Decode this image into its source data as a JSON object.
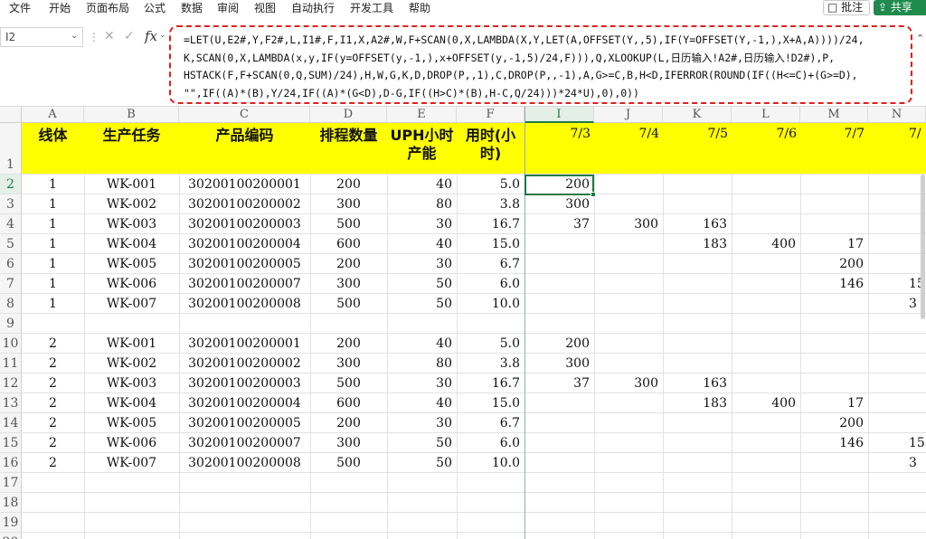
{
  "menu": [
    "文件",
    "开始",
    "页面布局",
    "公式",
    "数据",
    "审阅",
    "视图",
    "自动执行",
    "开发工具",
    "帮助"
  ],
  "comment_label": "批注",
  "share_label": "共享",
  "name_box": "I2",
  "fx_label": "fx",
  "formula_lines": [
    "=LET(U,E2#,Y,F2#,L,I1#,F,I1,X,A2#,W,F+SCAN(0,X,LAMBDA(X,Y,LET(A,OFFSET(Y,,5),IF(Y=OFFSET(Y,-1,),X+A,A))))/24,",
    "K,SCAN(0,X,LAMBDA(x,y,IF(y=OFFSET(y,-1,),x+OFFSET(y,-1,5)/24,F))),Q,XLOOKUP(L,日历输入!A2#,日历输入!D2#),P,",
    "HSTACK(F,F+SCAN(0,Q,SUM)/24),H,W,G,K,D,DROP(P,,1),C,DROP(P,,-1),A,G>=C,B,H<D,IFERROR(ROUND(IF((H<=C)+(G>=D),",
    "\"\",IF((A)*(B),Y/24,IF((A)*(G<D),D-G,IF((H>C)*(B),H-C,Q/24)))*24*U),0),0))"
  ],
  "columns": [
    "A",
    "B",
    "C",
    "D",
    "E",
    "F",
    "I",
    "J",
    "K",
    "L",
    "M",
    "N"
  ],
  "row_numbers": [
    "1",
    "2",
    "3",
    "4",
    "5",
    "6",
    "7",
    "8",
    "9",
    "10",
    "11",
    "12",
    "13",
    "14",
    "15",
    "16",
    "17",
    "18",
    "19",
    "20"
  ],
  "headers": {
    "line": "线体",
    "task": "生产任务",
    "code": "产品编码",
    "qty": "排程数量",
    "uph_1": "UPH小时",
    "uph_2": "产能",
    "time_1": "用时(小",
    "time_2": "时)"
  },
  "dates": [
    "7/3",
    "7/4",
    "7/5",
    "7/6",
    "7/7",
    "7/"
  ],
  "rows": [
    {
      "line": "1",
      "task": "WK-001",
      "code": "30200100200001",
      "qty": "200",
      "uph": "40",
      "time": "5.0",
      "d": [
        "200",
        "",
        "",
        "",
        "",
        ""
      ]
    },
    {
      "line": "1",
      "task": "WK-002",
      "code": "30200100200002",
      "qty": "300",
      "uph": "80",
      "time": "3.8",
      "d": [
        "300",
        "",
        "",
        "",
        "",
        ""
      ]
    },
    {
      "line": "1",
      "task": "WK-003",
      "code": "30200100200003",
      "qty": "500",
      "uph": "30",
      "time": "16.7",
      "d": [
        "37",
        "300",
        "163",
        "",
        "",
        ""
      ]
    },
    {
      "line": "1",
      "task": "WK-004",
      "code": "30200100200004",
      "qty": "600",
      "uph": "40",
      "time": "15.0",
      "d": [
        "",
        "",
        "183",
        "400",
        "17",
        ""
      ]
    },
    {
      "line": "1",
      "task": "WK-005",
      "code": "30200100200005",
      "qty": "200",
      "uph": "30",
      "time": "6.7",
      "d": [
        "",
        "",
        "",
        "",
        "200",
        ""
      ]
    },
    {
      "line": "1",
      "task": "WK-006",
      "code": "30200100200007",
      "qty": "300",
      "uph": "50",
      "time": "6.0",
      "d": [
        "",
        "",
        "",
        "",
        "146",
        "15"
      ]
    },
    {
      "line": "1",
      "task": "WK-007",
      "code": "30200100200008",
      "qty": "500",
      "uph": "50",
      "time": "10.0",
      "d": [
        "",
        "",
        "",
        "",
        "",
        "3"
      ]
    },
    {
      "line": "",
      "task": "",
      "code": "",
      "qty": "",
      "uph": "",
      "time": "",
      "d": [
        "",
        "",
        "",
        "",
        "",
        ""
      ]
    },
    {
      "line": "2",
      "task": "WK-001",
      "code": "30200100200001",
      "qty": "200",
      "uph": "40",
      "time": "5.0",
      "d": [
        "200",
        "",
        "",
        "",
        "",
        ""
      ]
    },
    {
      "line": "2",
      "task": "WK-002",
      "code": "30200100200002",
      "qty": "300",
      "uph": "80",
      "time": "3.8",
      "d": [
        "300",
        "",
        "",
        "",
        "",
        ""
      ]
    },
    {
      "line": "2",
      "task": "WK-003",
      "code": "30200100200003",
      "qty": "500",
      "uph": "30",
      "time": "16.7",
      "d": [
        "37",
        "300",
        "163",
        "",
        "",
        ""
      ]
    },
    {
      "line": "2",
      "task": "WK-004",
      "code": "30200100200004",
      "qty": "600",
      "uph": "40",
      "time": "15.0",
      "d": [
        "",
        "",
        "183",
        "400",
        "17",
        ""
      ]
    },
    {
      "line": "2",
      "task": "WK-005",
      "code": "30200100200005",
      "qty": "200",
      "uph": "30",
      "time": "6.7",
      "d": [
        "",
        "",
        "",
        "",
        "200",
        ""
      ]
    },
    {
      "line": "2",
      "task": "WK-006",
      "code": "30200100200007",
      "qty": "300",
      "uph": "50",
      "time": "6.0",
      "d": [
        "",
        "",
        "",
        "",
        "146",
        "15"
      ]
    },
    {
      "line": "2",
      "task": "WK-007",
      "code": "30200100200008",
      "qty": "500",
      "uph": "50",
      "time": "10.0",
      "d": [
        "",
        "",
        "",
        "",
        "",
        "3"
      ]
    }
  ],
  "colors": {
    "header_fill": "#ffff00",
    "accent": "#1e7a45",
    "formula_border": "#e0201c",
    "share_bg": "#1e8a4c"
  }
}
